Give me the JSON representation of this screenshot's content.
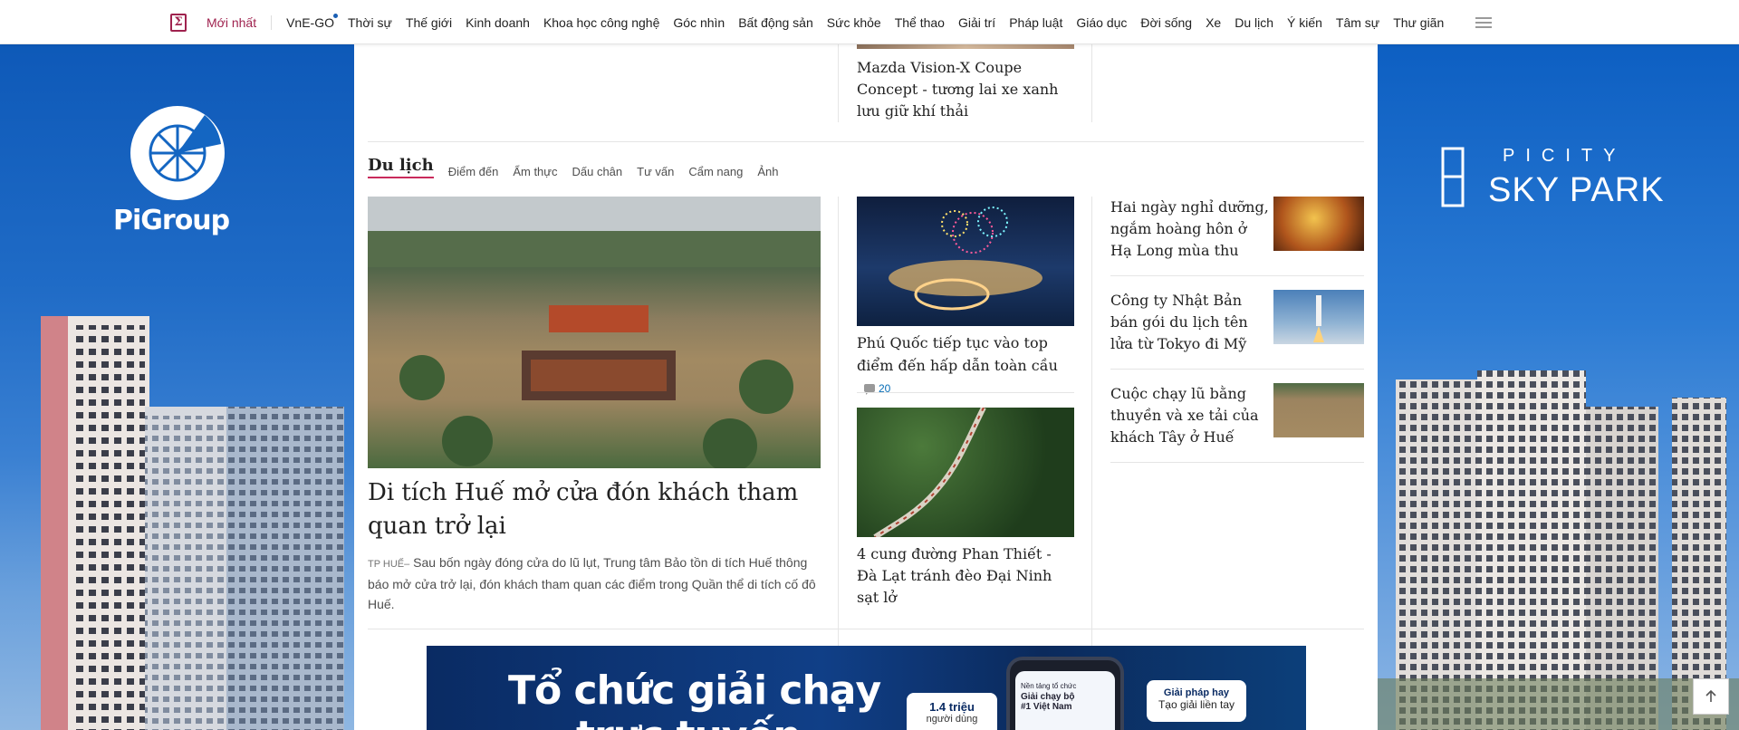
{
  "nav": {
    "logo_glyph": "Σ",
    "latest": "Mới nhất",
    "items": [
      "VnE-GO",
      "Thời sự",
      "Thế giới",
      "Kinh doanh",
      "Khoa học công nghệ",
      "Góc nhìn",
      "Bất động sản",
      "Sức khỏe",
      "Thể thao",
      "Giải trí",
      "Pháp luật",
      "Giáo dục",
      "Đời sống",
      "Xe",
      "Du lịch",
      "Ý kiến",
      "Tâm sự",
      "Thư giãn"
    ],
    "menu_icon": "hamburger-icon"
  },
  "ads": {
    "left_brand": "PiGroup",
    "right_brand_top": "PICITY",
    "right_brand_bottom": "SKY PARK"
  },
  "prev_section": {
    "car_title": "Mazda Vision-X Coupe Concept - tương lai xe xanh lưu giữ khí thải"
  },
  "section": {
    "title": "Du lịch",
    "subtabs": [
      "Điểm đến",
      "Ẩm thực",
      "Dấu chân",
      "Tư vấn",
      "Cẩm nang",
      "Ảnh"
    ]
  },
  "main_article": {
    "title": "Di tích Huế mở cửa đón khách tham quan trở lại",
    "location": "TP HUẾ",
    "lead": " Sau bốn ngày đóng cửa do lũ lụt, Trung tâm Bảo tồn di tích Huế thông báo mở cửa trở lại, đón khách tham quan các điểm trong Quần thể di tích cố đô Huế."
  },
  "mid_articles": [
    {
      "title": "Phú Quốc tiếp tục vào top điểm đến hấp dẫn toàn cầu",
      "comments": "20"
    },
    {
      "title": "4 cung đường Phan Thiết - Đà Lạt tránh đèo Đại Ninh sạt lở"
    }
  ],
  "side_articles": [
    {
      "title": "Hai ngày nghỉ dưỡng, ngắm hoàng hôn ở Hạ Long mùa thu"
    },
    {
      "title": "Công ty Nhật Bản bán gói du lịch tên lửa từ Tokyo đi Mỹ"
    },
    {
      "title": "Cuộc chạy lũ bằng thuyền và xe tải của khách Tây ở Huế"
    }
  ],
  "banner": {
    "headline_1": "Tổ chức giải chạy",
    "headline_2": "trực tuyến",
    "stat_value": "1.4 triệu",
    "stat_label": "người dùng",
    "phone_text_1": "Nền tảng tổ chức",
    "phone_text_2": "Giải chạy bộ",
    "phone_text_3": "#1 Việt Nam",
    "pill_1": "Giải pháp hay",
    "pill_2": "Tạo giải liền tay"
  },
  "back_to_top_icon": "arrow-up-icon"
}
